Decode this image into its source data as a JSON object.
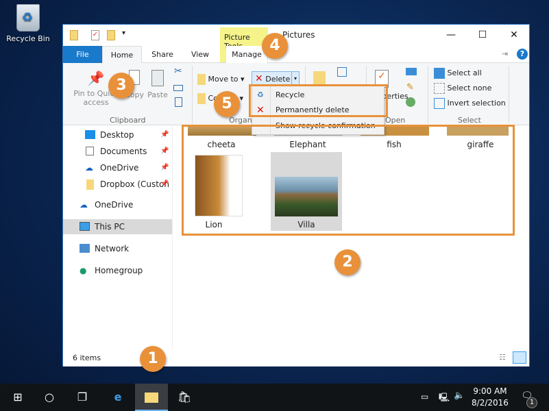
{
  "desktop": {
    "recycle_bin_label": "Recycle Bin"
  },
  "window": {
    "title": "Pictures",
    "contextual_tab_group": "Picture Tools",
    "tabs": [
      {
        "label": "File"
      },
      {
        "label": "Home"
      },
      {
        "label": "Share"
      },
      {
        "label": "View"
      },
      {
        "label": "Manage"
      }
    ],
    "ribbon": {
      "clipboard": {
        "pin_label": "Pin to Quick access",
        "copy_label": "Copy",
        "paste_label": "Paste",
        "group_label": "Clipboard"
      },
      "organize": {
        "move_to_label": "Move to",
        "copy_to_label": "Copy to",
        "delete_label": "Delete",
        "group_label": "Organize"
      },
      "open": {
        "properties_label": "Properties",
        "group_label": "Open"
      },
      "select": {
        "select_all": "Select all",
        "select_none": "Select none",
        "invert_selection": "Invert selection",
        "group_label": "Select"
      }
    },
    "delete_menu": {
      "items": [
        {
          "label": "Recycle",
          "icon": "recycle-icon"
        },
        {
          "label": "Permanently delete",
          "icon": "red-x-icon"
        },
        {
          "label": "Show recycle confirmation"
        }
      ]
    },
    "nav": {
      "items": [
        {
          "label": "Desktop",
          "pinned": true
        },
        {
          "label": "Documents",
          "pinned": true
        },
        {
          "label": "OneDrive",
          "pinned": true
        },
        {
          "label": "Dropbox (Custon",
          "pinned": true
        },
        {
          "label": "OneDrive"
        },
        {
          "label": "This PC",
          "selected": true
        },
        {
          "label": "Network"
        },
        {
          "label": "Homegroup"
        }
      ]
    },
    "files": [
      {
        "name": "cheeta"
      },
      {
        "name": "Elephant"
      },
      {
        "name": "fish"
      },
      {
        "name": "giraffe"
      },
      {
        "name": "Lion"
      },
      {
        "name": "Villa",
        "selected": true
      }
    ],
    "status": {
      "item_count": "6 items"
    }
  },
  "callouts": [
    "1",
    "2",
    "3",
    "4",
    "5"
  ],
  "taskbar": {
    "time": "9:00 AM",
    "date": "8/2/2016",
    "notification_count": "1"
  },
  "colors": {
    "accent": "#1979ca",
    "callout": "#e8913a",
    "picture_tools": "#f5f38a"
  }
}
